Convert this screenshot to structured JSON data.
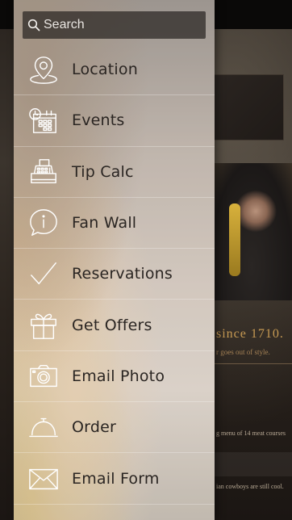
{
  "search": {
    "placeholder": "Search"
  },
  "menu": {
    "items": [
      {
        "label": "Location",
        "icon": "map-pin-icon"
      },
      {
        "label": "Events",
        "icon": "calendar-clock-icon"
      },
      {
        "label": "Tip Calc",
        "icon": "cash-register-icon"
      },
      {
        "label": "Fan Wall",
        "icon": "info-speech-bubble-icon"
      },
      {
        "label": "Reservations",
        "icon": "checkmark-icon"
      },
      {
        "label": "Get Offers",
        "icon": "gift-icon"
      },
      {
        "label": "Email Photo",
        "icon": "camera-icon"
      },
      {
        "label": "Order",
        "icon": "service-bell-icon"
      },
      {
        "label": "Email Form",
        "icon": "envelope-icon"
      }
    ]
  },
  "background": {
    "since_text": "since 1710.",
    "since_subtext": "r goes out of style.",
    "menu_text": "g menu of 14 meat courses",
    "cowboys_text": "ian cowboys are still cool."
  },
  "colors": {
    "label_text": "#2a2522",
    "icon_stroke": "#ffffff",
    "search_bg": "#28241f",
    "accent_gold": "#c79a53"
  }
}
